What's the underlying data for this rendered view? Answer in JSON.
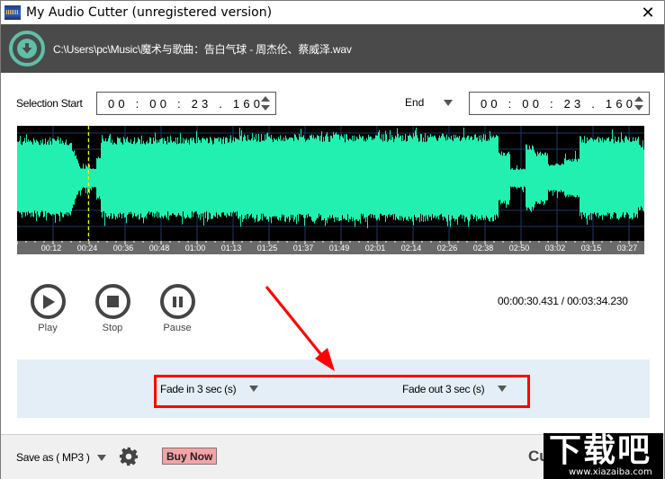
{
  "window": {
    "title": "My Audio Cutter (unregistered version)",
    "close_glyph": "✕"
  },
  "file": {
    "path": "C:\\Users\\pc\\Music\\魔术与歌曲：告白气球 - 周杰伦、蔡威泽.wav",
    "open_icon": "download-circle-icon"
  },
  "selection": {
    "start_label": "Selection Start",
    "start_value": "00 : 00 : 23 . 160",
    "end_label": "End",
    "end_value": "00 : 00 : 23 . 160"
  },
  "waveform": {
    "color": "#22f0b0",
    "background": "#000000",
    "grid_color": "#1e3a5f",
    "cursor_color": "#ffff00",
    "cursor_time_sec": 23.16,
    "duration_sec": 214.23,
    "time_labels": [
      "00:12",
      "00:24",
      "00:36",
      "00:48",
      "01:00",
      "01:13",
      "01:25",
      "01:37",
      "01:49",
      "02:01",
      "02:14",
      "02:26",
      "02:38",
      "02:50",
      "03:02",
      "03:15",
      "03:27"
    ]
  },
  "controls": {
    "play_label": "Play",
    "stop_label": "Stop",
    "pause_label": "Pause"
  },
  "position": {
    "text": "00:00:30.431 / 00:03:34.230"
  },
  "fade": {
    "fade_in": "Fade in 3 sec (s)",
    "fade_out": "Fade out 3 sec (s)"
  },
  "bottom": {
    "save_as": "Save as ( MP3 )",
    "buy_now": "Buy Now",
    "cut_label": "Cut"
  },
  "watermark": {
    "big": "下载吧",
    "url": "www.xiazaiba.com"
  },
  "annotation": {
    "highlight_color": "#ff0000"
  }
}
